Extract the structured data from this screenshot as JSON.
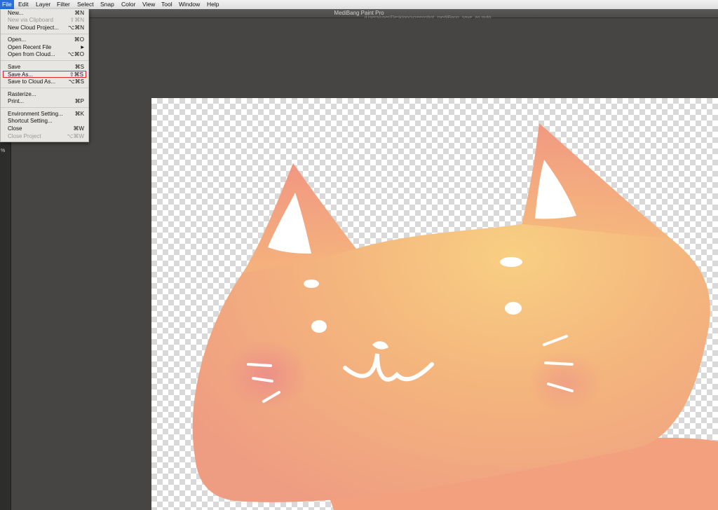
{
  "app": {
    "title": "MediBang Paint Pro",
    "path": "/Users/user/Desktop/screenshot_mediBang_save_as.mdp"
  },
  "menubar": {
    "items": [
      "File",
      "Edit",
      "Layer",
      "Filter",
      "Select",
      "Snap",
      "Color",
      "View",
      "Tool",
      "Window",
      "Help"
    ],
    "active": "File"
  },
  "file_menu": {
    "items": [
      {
        "label": "New...",
        "shortcut": "⌘N",
        "enabled": true
      },
      {
        "label": "New via Clipboard",
        "shortcut": "⇧⌘N",
        "enabled": false
      },
      {
        "label": "New Cloud Project...",
        "shortcut": "⌥⌘N",
        "enabled": true
      },
      {
        "label": "Open...",
        "shortcut": "⌘O",
        "enabled": true
      },
      {
        "label": "Open Recent File",
        "shortcut": "▶",
        "enabled": true
      },
      {
        "label": "Open from Cloud...",
        "shortcut": "⌥⌘O",
        "enabled": true
      },
      {
        "label": "Save",
        "shortcut": "⌘S",
        "enabled": true
      },
      {
        "label": "Save As...",
        "shortcut": "⇧⌘S",
        "enabled": true,
        "highlighted": true
      },
      {
        "label": "Save to Cloud As...",
        "shortcut": "⌥⌘S",
        "enabled": true
      },
      {
        "label": "Rasterize...",
        "shortcut": "",
        "enabled": true
      },
      {
        "label": "Print...",
        "shortcut": "⌘P",
        "enabled": true
      },
      {
        "label": "Environment Setting...",
        "shortcut": "⌘K",
        "enabled": true
      },
      {
        "label": "Shortcut Setting...",
        "shortcut": "",
        "enabled": true
      },
      {
        "label": "Close",
        "shortcut": "⌘W",
        "enabled": true
      },
      {
        "label": "Close Project",
        "shortcut": "⌥⌘W",
        "enabled": false
      }
    ]
  },
  "tool_strip": {
    "zoom_suffix": "%"
  },
  "canvas": {
    "background": "transparent-checkerboard",
    "artwork": "orange-cat-illustration",
    "colors": {
      "cat_body": "#f3a57e",
      "cat_highlight": "#f7cf84",
      "cat_pink": "#ef8f8a"
    }
  },
  "colors": {
    "menu_highlight": "#2a6fd9",
    "selection_border": "#e0262d",
    "workspace": "#464543"
  }
}
